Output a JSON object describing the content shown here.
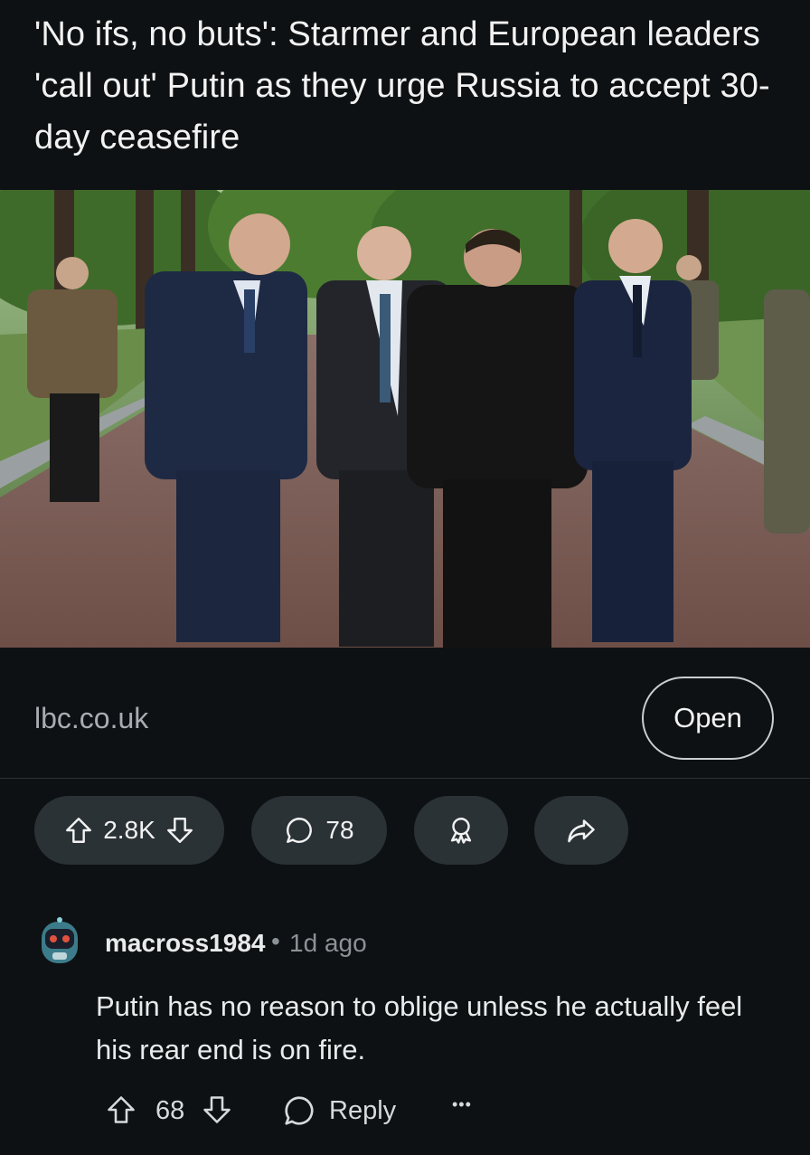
{
  "post": {
    "title": "'No ifs, no buts': Starmer and European leaders 'call out' Putin as they urge Russia to accept 30-day ceasefire",
    "link_domain": "lbc.co.uk",
    "open_label": "Open",
    "score": "2.8K",
    "comment_count": "78"
  },
  "icons": {
    "upvote": "arrow-up-icon",
    "downvote": "arrow-down-icon",
    "comments": "speech-bubble-icon",
    "award": "award-icon",
    "share": "share-arrow-icon",
    "more": "ellipsis-icon"
  },
  "comment": {
    "author": "macross1984",
    "separator": "•",
    "age": "1d ago",
    "body": "Putin has no reason to oblige unless he actually feel his rear end is on fire.",
    "score": "68",
    "reply_label": "Reply",
    "more_label": "•••"
  },
  "colors": {
    "background": "#0e1113",
    "pill": "#2a3236",
    "text": "#f2f2f2",
    "muted": "#8b9296"
  }
}
